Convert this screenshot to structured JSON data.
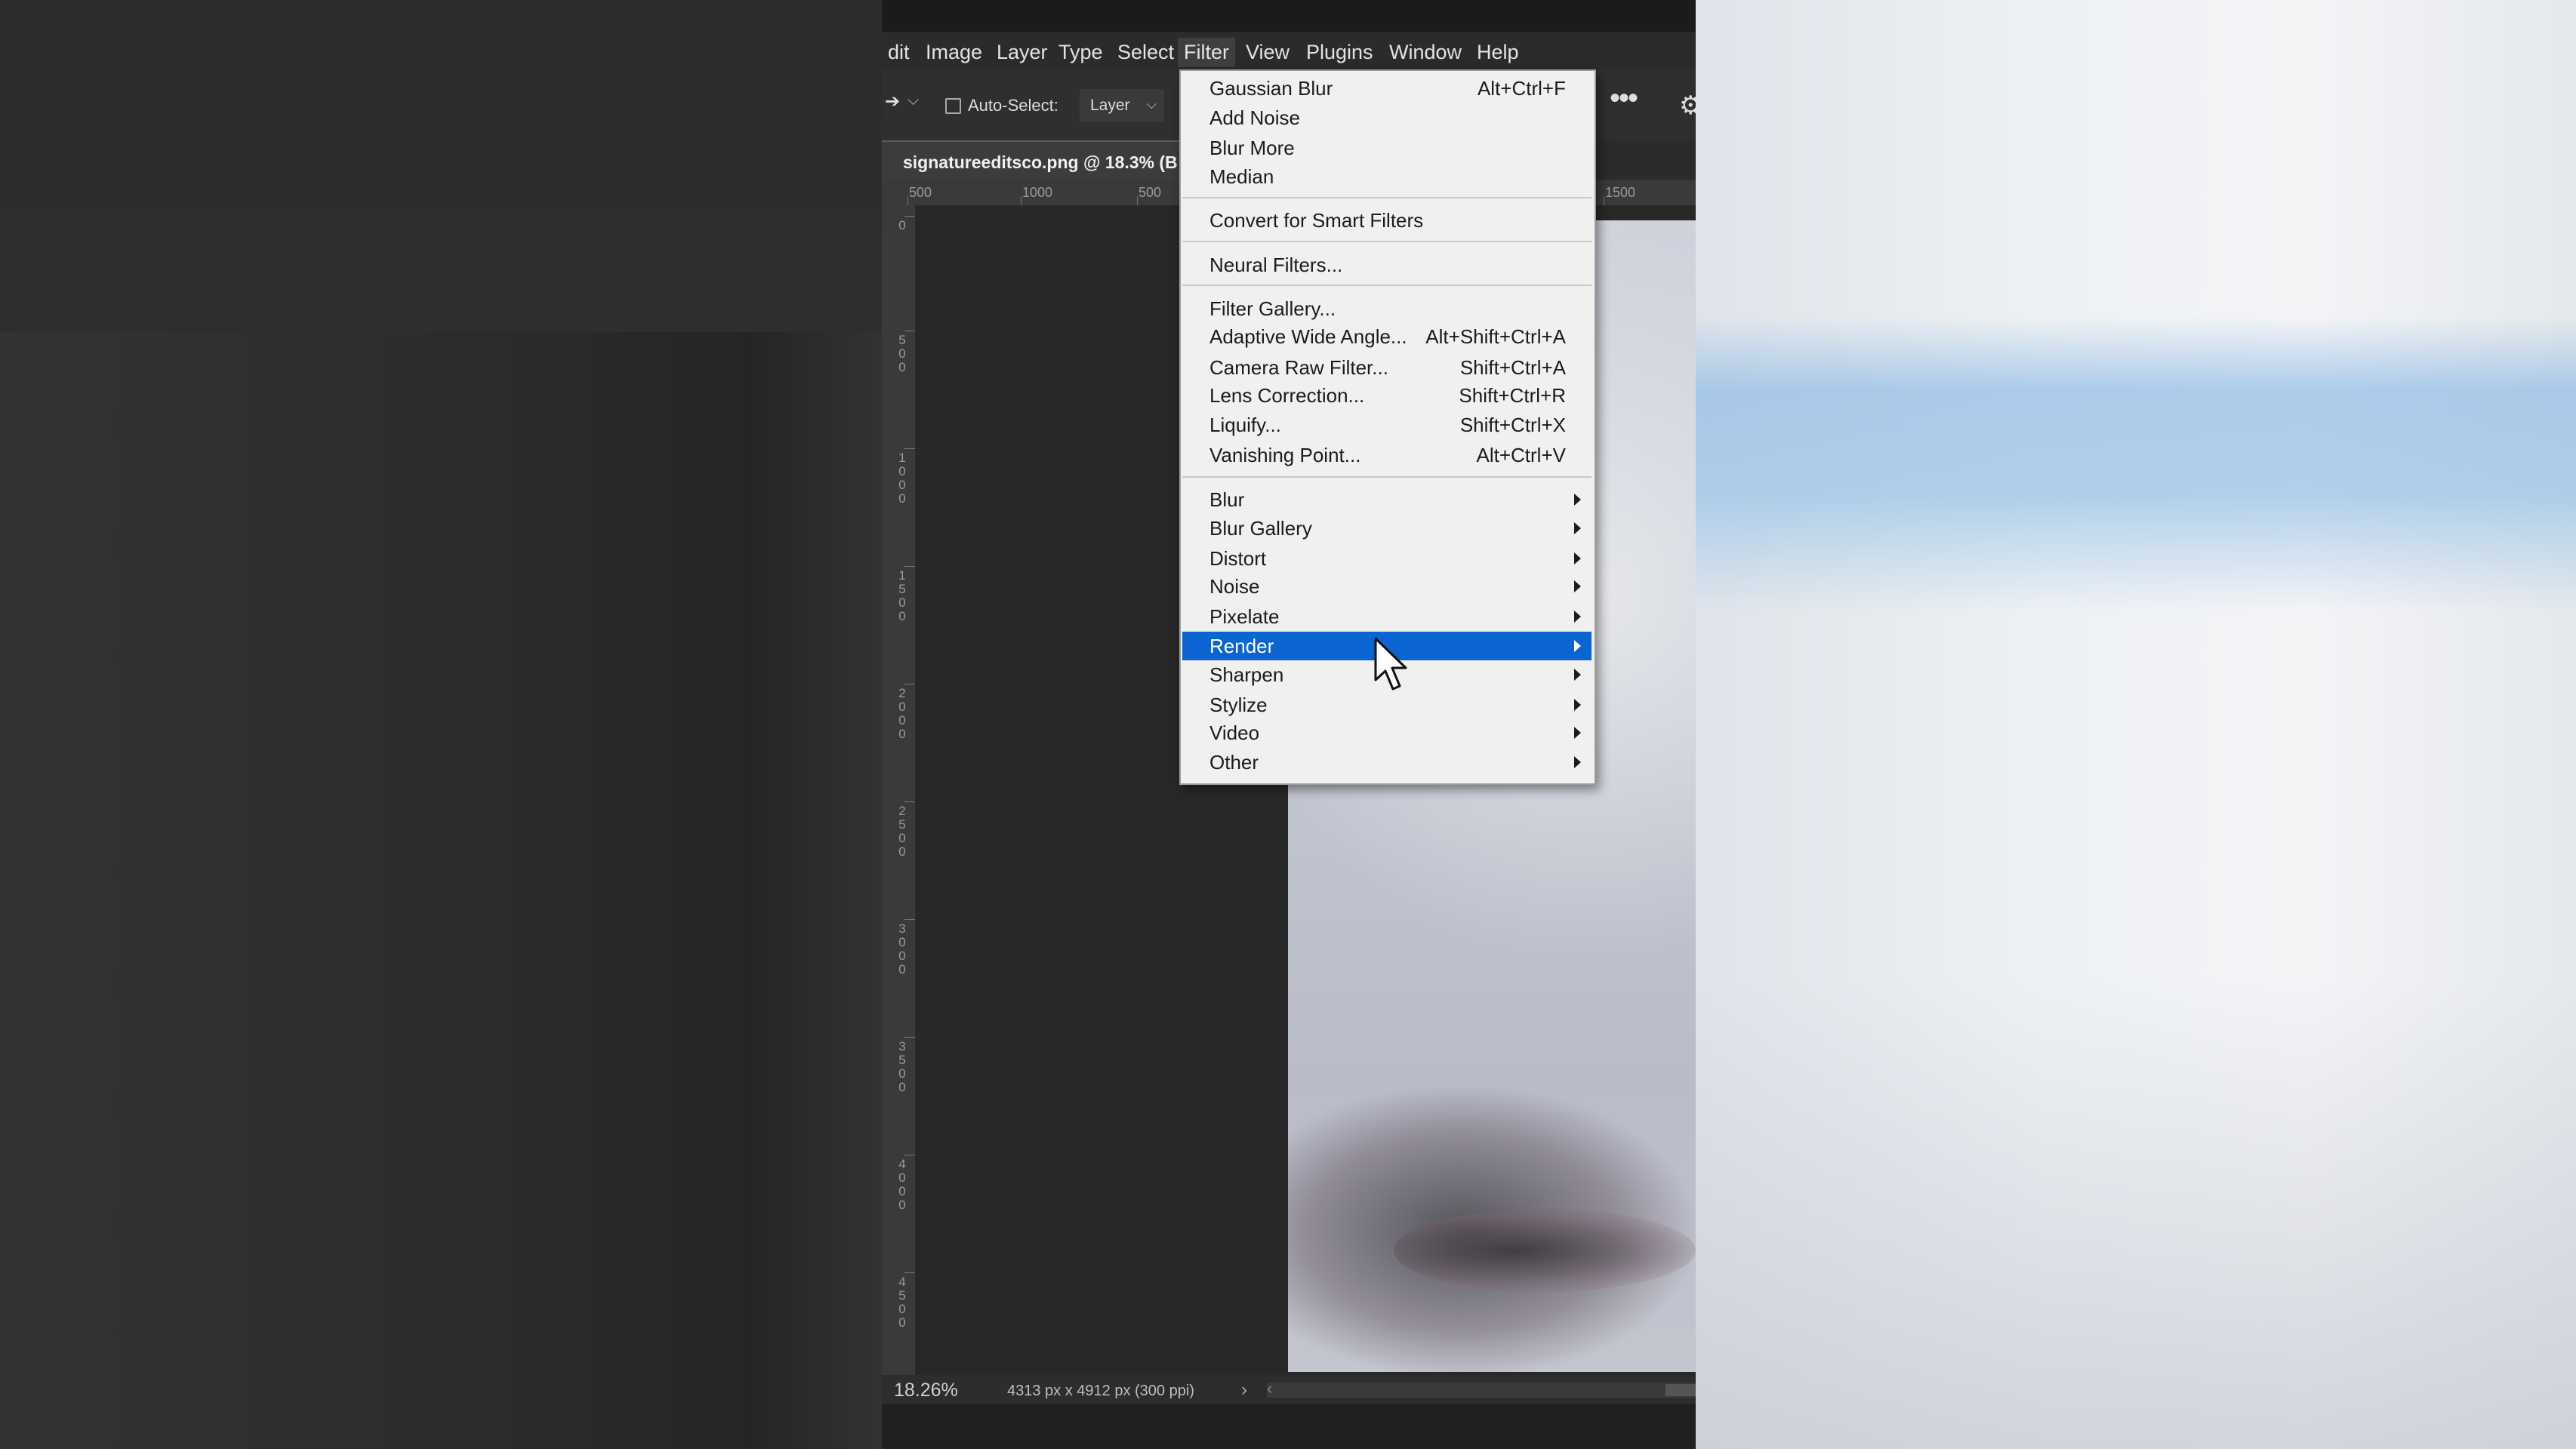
{
  "menubar": {
    "items": [
      {
        "label": "dit"
      },
      {
        "label": "Image"
      },
      {
        "label": "Layer"
      },
      {
        "label": "Type"
      },
      {
        "label": "Select"
      },
      {
        "label": "Filter"
      },
      {
        "label": "View"
      },
      {
        "label": "Plugins"
      },
      {
        "label": "Window"
      },
      {
        "label": "Help"
      }
    ],
    "active": "Filter"
  },
  "options_bar": {
    "auto_select_label": "Auto-Select:",
    "auto_select_checked": false,
    "target_select": "Layer",
    "more_icon": "ellipsis-icon",
    "settings_icon": "gear-icon"
  },
  "document": {
    "tab_title": "signatureeditsco.png @ 18.3% (B"
  },
  "rulers": {
    "top_labels": [
      "500",
      "1000",
      "500",
      "1500"
    ],
    "left_labels": [
      "0",
      "500",
      "1000",
      "1500",
      "2000",
      "2500",
      "3000",
      "3500",
      "4000",
      "4500"
    ]
  },
  "filter_menu": {
    "groups": [
      [
        {
          "label": "Gaussian Blur",
          "shortcut": "Alt+Ctrl+F"
        },
        {
          "label": "Add Noise",
          "shortcut": ""
        },
        {
          "label": "Blur More",
          "shortcut": ""
        },
        {
          "label": "Median",
          "shortcut": ""
        }
      ],
      [
        {
          "label": "Convert for Smart Filters",
          "shortcut": ""
        }
      ],
      [
        {
          "label": "Neural Filters...",
          "shortcut": ""
        }
      ],
      [
        {
          "label": "Filter Gallery...",
          "shortcut": ""
        },
        {
          "label": "Adaptive Wide Angle...",
          "shortcut": "Alt+Shift+Ctrl+A"
        },
        {
          "label": "Camera Raw Filter...",
          "shortcut": "Shift+Ctrl+A"
        },
        {
          "label": "Lens Correction...",
          "shortcut": "Shift+Ctrl+R"
        },
        {
          "label": "Liquify...",
          "shortcut": "Shift+Ctrl+X"
        },
        {
          "label": "Vanishing Point...",
          "shortcut": "Alt+Ctrl+V"
        }
      ],
      [
        {
          "label": "Blur",
          "submenu": true
        },
        {
          "label": "Blur Gallery",
          "submenu": true
        },
        {
          "label": "Distort",
          "submenu": true
        },
        {
          "label": "Noise",
          "submenu": true
        },
        {
          "label": "Pixelate",
          "submenu": true
        },
        {
          "label": "Render",
          "submenu": true,
          "highlighted": true
        },
        {
          "label": "Sharpen",
          "submenu": true
        },
        {
          "label": "Stylize",
          "submenu": true
        },
        {
          "label": "Video",
          "submenu": true
        },
        {
          "label": "Other",
          "submenu": true
        }
      ]
    ]
  },
  "status_bar": {
    "zoom": "18.26%",
    "doc_info": "4313 px x 4912 px (300 ppi)",
    "arrow_icon": "chevron-right-icon",
    "scroll_left_icon": "chevron-left-icon"
  },
  "colors": {
    "menu_highlight": "#0a64d2",
    "menu_bg": "#f0f0f0",
    "app_dark": "#2b2b2b"
  }
}
